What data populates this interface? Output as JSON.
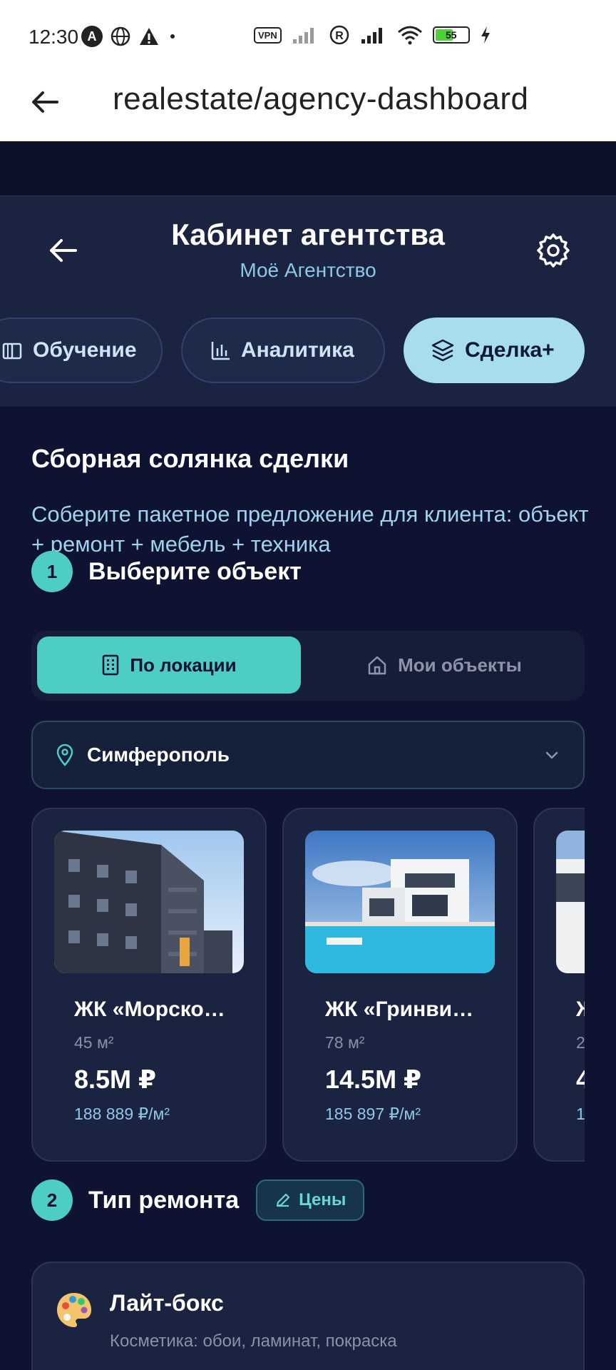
{
  "status_bar": {
    "time": "12:30",
    "vpn": "VPN",
    "battery_level": "55",
    "battery_fraction": 0.55,
    "icons": [
      "a-icon",
      "globe-icon",
      "warning-icon",
      "dot-icon",
      "vpn-icon",
      "signal-icon",
      "registered-icon",
      "signal-icon",
      "wifi-icon",
      "battery-icon",
      "charging-icon"
    ]
  },
  "browser": {
    "title": "realestate/agency-dashboard"
  },
  "header": {
    "title": "Кабинет агентства",
    "subtitle": "Моё Агентство"
  },
  "tabs": [
    {
      "label": "Обучение",
      "icon": "book-icon",
      "active": false
    },
    {
      "label": "Аналитика",
      "icon": "bar-chart-icon",
      "active": false
    },
    {
      "label": "Сделка+",
      "icon": "layers-icon",
      "active": true
    }
  ],
  "section": {
    "title": "Сборная солянка сделки",
    "description": "Соберите пакетное предложение для клиента: объект + ремонт + мебель + техника"
  },
  "step1": {
    "number": "1",
    "label": "Выберите объект",
    "segments": [
      {
        "label": "По локации",
        "icon": "building-icon",
        "active": true
      },
      {
        "label": "Мои объекты",
        "icon": "home-icon",
        "active": false
      }
    ],
    "location": "Симферополь"
  },
  "properties": [
    {
      "name": "ЖК «Морско…",
      "area": "45 м²",
      "price": "8.5M ₽",
      "price_per_m2": "188 889 ₽/м²"
    },
    {
      "name": "ЖК «Гринви…",
      "area": "78 м²",
      "price": "14.5M ₽",
      "price_per_m2": "185 897 ₽/м²"
    },
    {
      "name": "Ж",
      "area": "2",
      "price": "4",
      "price_per_m2": "1"
    }
  ],
  "step2": {
    "number": "2",
    "label": "Тип ремонта",
    "prices_button": "Цены"
  },
  "repair_option": {
    "icon": "palette-icon",
    "title": "Лайт-бокс",
    "description": "Косметика: обои, ламинат, покраска"
  },
  "colors": {
    "accent": "#4ecdc4",
    "active_tab": "#a8dcef",
    "background": "#0d1330",
    "card": "#1a2440"
  }
}
